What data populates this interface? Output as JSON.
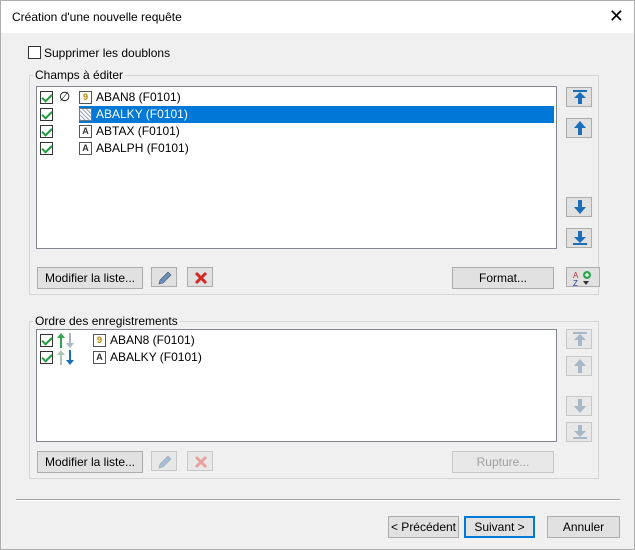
{
  "window": {
    "title": "Création d'une nouvelle requête",
    "close_symbol": "✕"
  },
  "remove_duplicates": {
    "label": "Supprimer les doublons",
    "checked": false
  },
  "fields_group": {
    "title": "Champs à éditer",
    "rows": [
      {
        "label": "ABAN8 (F0101)",
        "checked": true,
        "null_marker": "∅",
        "icon": "numeric-field-icon",
        "icon_text": "9",
        "selected": false
      },
      {
        "label": "ABALKY (F0101)",
        "checked": true,
        "null_marker": "",
        "icon": "hatched-field-icon",
        "icon_text": "",
        "selected": true
      },
      {
        "label": "ABTAX (F0101)",
        "checked": true,
        "null_marker": "",
        "icon": "text-field-icon",
        "icon_text": "A",
        "selected": false
      },
      {
        "label": "ABALPH (F0101)",
        "checked": true,
        "null_marker": "",
        "icon": "text-field-icon",
        "icon_text": "A",
        "selected": false
      }
    ],
    "modify_label": "Modifier la liste...",
    "format_label": "Format..."
  },
  "order_group": {
    "title": "Ordre des enregistrements",
    "rows": [
      {
        "label": "ABAN8 (F0101)",
        "checked": true,
        "direction": "ascending",
        "icon": "numeric-field-icon",
        "icon_text": "9"
      },
      {
        "label": "ABALKY (F0101)",
        "checked": true,
        "direction": "descending",
        "icon": "text-field-icon",
        "icon_text": "A"
      }
    ],
    "modify_label": "Modifier la liste...",
    "break_label": "Rupture..."
  },
  "footer": {
    "previous_label": "< Précédent",
    "next_label": "Suivant >",
    "cancel_label": "Annuler"
  },
  "colors": {
    "selection": "#0078d7",
    "check": "#1f9b3a",
    "arrow": "#1a6fb8",
    "delete": "#d6261f",
    "up_arrow_green": "#2fa84f"
  }
}
